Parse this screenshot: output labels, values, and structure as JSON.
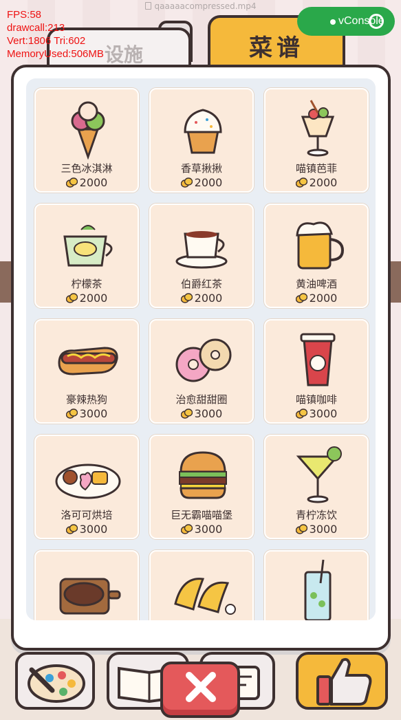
{
  "window": {
    "file_name": "qaaaaacompressed.mp4"
  },
  "tabs": {
    "facility_label": "设施",
    "recipe_label": "菜谱"
  },
  "debug": {
    "fps": "FPS:58",
    "drawcall": "drawcall:213",
    "vert_tri": "Vert:1806 Tri:602",
    "memory": "MemoryUsed:506MB"
  },
  "vconsole_label": "vConsole",
  "colors": {
    "accent": "#f5b93b",
    "card_bg": "#fbeadb",
    "close": "#e4595b",
    "outline": "#3d3030"
  },
  "recipes": [
    {
      "name": "三色冰淇淋",
      "price": "2000",
      "icon": "ice-cream-icon"
    },
    {
      "name": "香草揪揪",
      "price": "2000",
      "icon": "cupcake-icon"
    },
    {
      "name": "喵镇芭菲",
      "price": "2000",
      "icon": "parfait-icon"
    },
    {
      "name": "柠檬茶",
      "price": "2000",
      "icon": "lemon-tea-icon"
    },
    {
      "name": "伯爵红茶",
      "price": "2000",
      "icon": "earl-grey-tea-icon"
    },
    {
      "name": "黄油啤酒",
      "price": "2000",
      "icon": "butterbeer-icon"
    },
    {
      "name": "豪辣热狗",
      "price": "3000",
      "icon": "hotdog-icon"
    },
    {
      "name": "治愈甜甜圈",
      "price": "3000",
      "icon": "donut-icon"
    },
    {
      "name": "喵镇咖啡",
      "price": "3000",
      "icon": "coffee-cup-icon"
    },
    {
      "name": "洛可可烘培",
      "price": "3000",
      "icon": "pastry-plate-icon"
    },
    {
      "name": "巨无霸喵喵堡",
      "price": "3000",
      "icon": "burger-icon"
    },
    {
      "name": "青柠冻饮",
      "price": "3000",
      "icon": "lime-cocktail-icon"
    },
    {
      "name": "",
      "price": "",
      "icon": "steak-icon"
    },
    {
      "name": "",
      "price": "",
      "icon": "taco-icon"
    },
    {
      "name": "",
      "price": "",
      "icon": "mojito-icon"
    }
  ],
  "bottom_bar": {
    "icons": [
      "palette-icon",
      "book-icon",
      "menu-board-icon",
      "thumbs-up-icon"
    ]
  },
  "close_button_icon": "close-icon"
}
